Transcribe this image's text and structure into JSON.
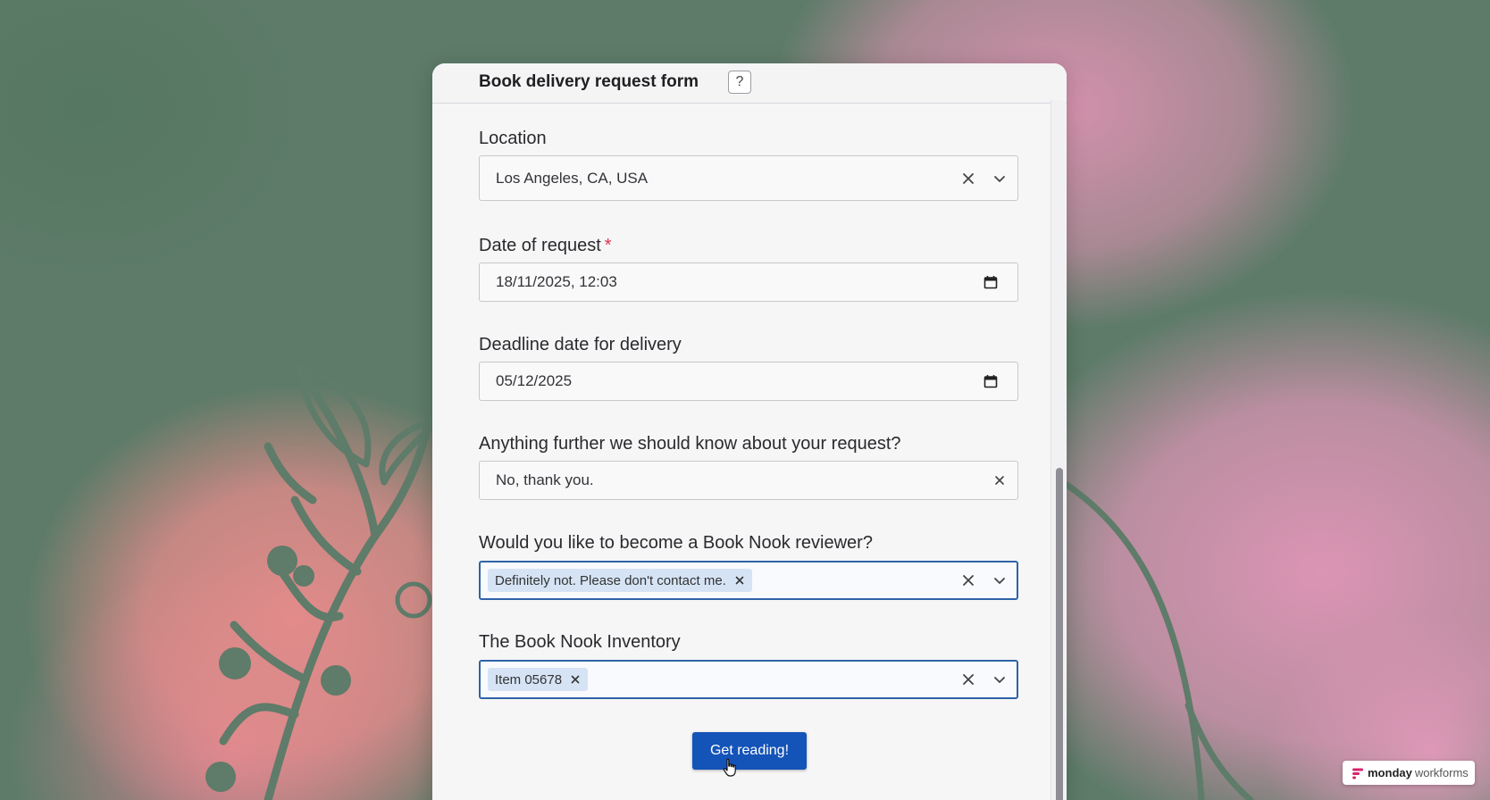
{
  "form": {
    "title": "Book delivery request form",
    "help_label": "?"
  },
  "fields": {
    "location": {
      "label": "Location",
      "value": "Los Angeles, CA, USA"
    },
    "date_of_request": {
      "label": "Date of request",
      "required_mark": "*",
      "value": "18/11/2025, 12:03"
    },
    "deadline": {
      "label": "Deadline date for delivery",
      "value": "05/12/2025"
    },
    "further_info": {
      "label": "Anything further we should know about your request?",
      "value": "No, thank you."
    },
    "reviewer": {
      "label": "Would you like to become a Book Nook reviewer?",
      "selected": "Definitely not. Please don't contact me."
    },
    "inventory": {
      "label": "The Book Nook Inventory",
      "selected": "Item 05678"
    }
  },
  "submit": {
    "label": "Get reading!"
  },
  "branding": {
    "brand": "monday",
    "product": "workforms"
  },
  "colors": {
    "primary_button": "#1453b8",
    "chip_bg": "#d5e3f5",
    "focus_border": "#2f63a8",
    "required": "#d9344b"
  },
  "icons": {
    "clear": "clear-x-icon",
    "dropdown": "chevron-down-icon",
    "calendar": "calendar-icon",
    "cursor": "hand-pointer-icon",
    "logo": "monday-logo-icon"
  }
}
